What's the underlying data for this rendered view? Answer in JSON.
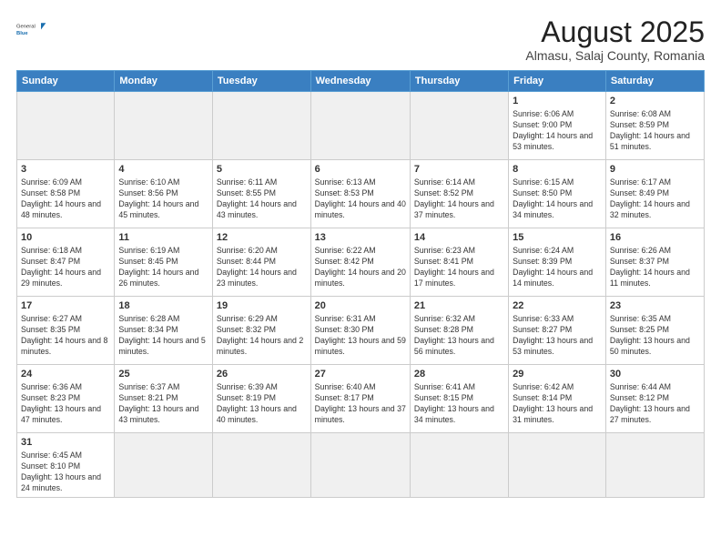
{
  "logo": {
    "text_general": "General",
    "text_blue": "Blue"
  },
  "title": "August 2025",
  "subtitle": "Almasu, Salaj County, Romania",
  "days_of_week": [
    "Sunday",
    "Monday",
    "Tuesday",
    "Wednesday",
    "Thursday",
    "Friday",
    "Saturday"
  ],
  "weeks": [
    [
      {
        "day": "",
        "info": ""
      },
      {
        "day": "",
        "info": ""
      },
      {
        "day": "",
        "info": ""
      },
      {
        "day": "",
        "info": ""
      },
      {
        "day": "",
        "info": ""
      },
      {
        "day": "1",
        "info": "Sunrise: 6:06 AM\nSunset: 9:00 PM\nDaylight: 14 hours and 53 minutes."
      },
      {
        "day": "2",
        "info": "Sunrise: 6:08 AM\nSunset: 8:59 PM\nDaylight: 14 hours and 51 minutes."
      }
    ],
    [
      {
        "day": "3",
        "info": "Sunrise: 6:09 AM\nSunset: 8:58 PM\nDaylight: 14 hours and 48 minutes."
      },
      {
        "day": "4",
        "info": "Sunrise: 6:10 AM\nSunset: 8:56 PM\nDaylight: 14 hours and 45 minutes."
      },
      {
        "day": "5",
        "info": "Sunrise: 6:11 AM\nSunset: 8:55 PM\nDaylight: 14 hours and 43 minutes."
      },
      {
        "day": "6",
        "info": "Sunrise: 6:13 AM\nSunset: 8:53 PM\nDaylight: 14 hours and 40 minutes."
      },
      {
        "day": "7",
        "info": "Sunrise: 6:14 AM\nSunset: 8:52 PM\nDaylight: 14 hours and 37 minutes."
      },
      {
        "day": "8",
        "info": "Sunrise: 6:15 AM\nSunset: 8:50 PM\nDaylight: 14 hours and 34 minutes."
      },
      {
        "day": "9",
        "info": "Sunrise: 6:17 AM\nSunset: 8:49 PM\nDaylight: 14 hours and 32 minutes."
      }
    ],
    [
      {
        "day": "10",
        "info": "Sunrise: 6:18 AM\nSunset: 8:47 PM\nDaylight: 14 hours and 29 minutes."
      },
      {
        "day": "11",
        "info": "Sunrise: 6:19 AM\nSunset: 8:45 PM\nDaylight: 14 hours and 26 minutes."
      },
      {
        "day": "12",
        "info": "Sunrise: 6:20 AM\nSunset: 8:44 PM\nDaylight: 14 hours and 23 minutes."
      },
      {
        "day": "13",
        "info": "Sunrise: 6:22 AM\nSunset: 8:42 PM\nDaylight: 14 hours and 20 minutes."
      },
      {
        "day": "14",
        "info": "Sunrise: 6:23 AM\nSunset: 8:41 PM\nDaylight: 14 hours and 17 minutes."
      },
      {
        "day": "15",
        "info": "Sunrise: 6:24 AM\nSunset: 8:39 PM\nDaylight: 14 hours and 14 minutes."
      },
      {
        "day": "16",
        "info": "Sunrise: 6:26 AM\nSunset: 8:37 PM\nDaylight: 14 hours and 11 minutes."
      }
    ],
    [
      {
        "day": "17",
        "info": "Sunrise: 6:27 AM\nSunset: 8:35 PM\nDaylight: 14 hours and 8 minutes."
      },
      {
        "day": "18",
        "info": "Sunrise: 6:28 AM\nSunset: 8:34 PM\nDaylight: 14 hours and 5 minutes."
      },
      {
        "day": "19",
        "info": "Sunrise: 6:29 AM\nSunset: 8:32 PM\nDaylight: 14 hours and 2 minutes."
      },
      {
        "day": "20",
        "info": "Sunrise: 6:31 AM\nSunset: 8:30 PM\nDaylight: 13 hours and 59 minutes."
      },
      {
        "day": "21",
        "info": "Sunrise: 6:32 AM\nSunset: 8:28 PM\nDaylight: 13 hours and 56 minutes."
      },
      {
        "day": "22",
        "info": "Sunrise: 6:33 AM\nSunset: 8:27 PM\nDaylight: 13 hours and 53 minutes."
      },
      {
        "day": "23",
        "info": "Sunrise: 6:35 AM\nSunset: 8:25 PM\nDaylight: 13 hours and 50 minutes."
      }
    ],
    [
      {
        "day": "24",
        "info": "Sunrise: 6:36 AM\nSunset: 8:23 PM\nDaylight: 13 hours and 47 minutes."
      },
      {
        "day": "25",
        "info": "Sunrise: 6:37 AM\nSunset: 8:21 PM\nDaylight: 13 hours and 43 minutes."
      },
      {
        "day": "26",
        "info": "Sunrise: 6:39 AM\nSunset: 8:19 PM\nDaylight: 13 hours and 40 minutes."
      },
      {
        "day": "27",
        "info": "Sunrise: 6:40 AM\nSunset: 8:17 PM\nDaylight: 13 hours and 37 minutes."
      },
      {
        "day": "28",
        "info": "Sunrise: 6:41 AM\nSunset: 8:15 PM\nDaylight: 13 hours and 34 minutes."
      },
      {
        "day": "29",
        "info": "Sunrise: 6:42 AM\nSunset: 8:14 PM\nDaylight: 13 hours and 31 minutes."
      },
      {
        "day": "30",
        "info": "Sunrise: 6:44 AM\nSunset: 8:12 PM\nDaylight: 13 hours and 27 minutes."
      }
    ],
    [
      {
        "day": "31",
        "info": "Sunrise: 6:45 AM\nSunset: 8:10 PM\nDaylight: 13 hours and 24 minutes."
      },
      {
        "day": "",
        "info": ""
      },
      {
        "day": "",
        "info": ""
      },
      {
        "day": "",
        "info": ""
      },
      {
        "day": "",
        "info": ""
      },
      {
        "day": "",
        "info": ""
      },
      {
        "day": "",
        "info": ""
      }
    ]
  ]
}
